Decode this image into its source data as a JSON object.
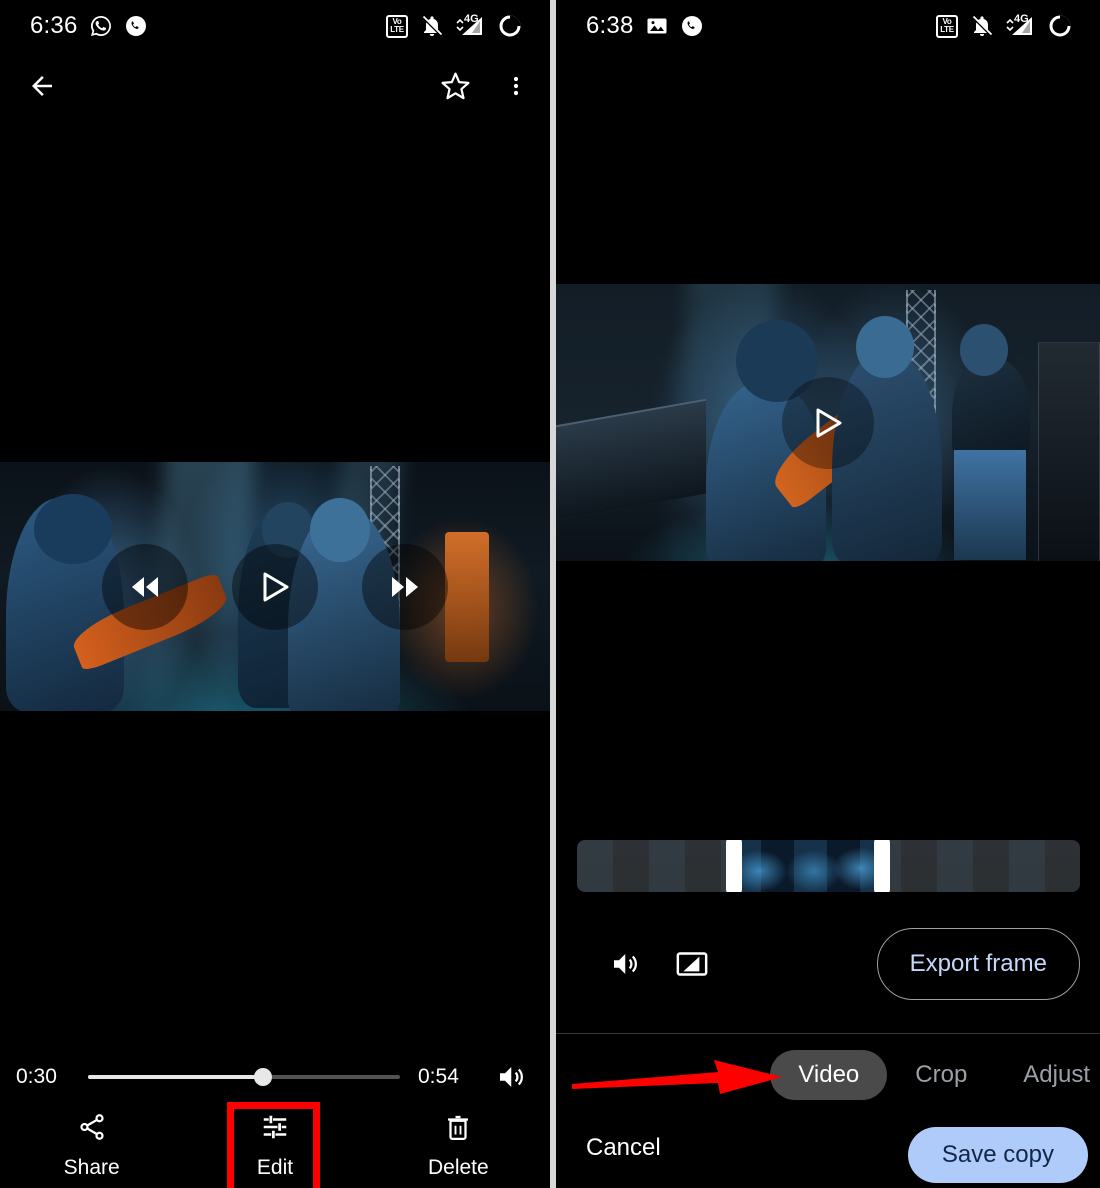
{
  "left_panel": {
    "status_bar": {
      "time": "6:36",
      "left_icons": [
        "whatsapp-icon",
        "phone-call-icon"
      ],
      "right_icons": [
        "volte-icon",
        "notifications-muted-icon",
        "signal-4g-icon",
        "battery-icon"
      ],
      "volte_top": "Vo",
      "volte_bottom": "LTE",
      "network_label": "4G"
    },
    "appbar": {
      "back": "back-arrow-icon",
      "favorite": "star-outline-icon",
      "overflow": "more-vert-icon"
    },
    "player": {
      "rewind": "rewind-10-icon",
      "play": "play-icon",
      "forward": "forward-10-icon"
    },
    "seek": {
      "current_time": "0:30",
      "total_time": "0:54",
      "progress_percent": 56,
      "volume_icon": "volume-up-icon"
    },
    "actions": [
      {
        "label": "Share",
        "icon": "share-icon",
        "highlighted": false
      },
      {
        "label": "Edit",
        "icon": "tune-sliders-icon",
        "highlighted": true
      },
      {
        "label": "Delete",
        "icon": "trash-icon",
        "highlighted": false
      }
    ],
    "highlight_color": "#ff0000"
  },
  "right_panel": {
    "status_bar": {
      "time": "6:38",
      "left_icons": [
        "photos-image-icon",
        "phone-call-icon"
      ],
      "right_icons": [
        "volte-icon",
        "notifications-muted-icon",
        "signal-4g-icon",
        "battery-icon"
      ],
      "volte_top": "Vo",
      "volte_bottom": "LTE",
      "network_label": "4G"
    },
    "player": {
      "play": "play-icon"
    },
    "trim": {
      "start_handle_percent": 30,
      "end_handle_percent": 61
    },
    "video_tools": [
      {
        "icon": "volume-up-icon",
        "name": "mute-toggle"
      },
      {
        "icon": "stabilize-frame-icon",
        "name": "stabilize-toggle"
      }
    ],
    "export_button": {
      "label": "Export frame"
    },
    "tabs": [
      {
        "label": "Video",
        "active": true
      },
      {
        "label": "Crop",
        "active": false
      },
      {
        "label": "Adjust",
        "active": false
      }
    ],
    "cancel_button": {
      "label": "Cancel"
    },
    "save_button": {
      "label": "Save copy"
    },
    "annotation_arrow": {
      "name": "red-pointer-arrow",
      "color": "#ff0000",
      "points_to": "Video"
    },
    "accent_color": "#aecbfa"
  }
}
